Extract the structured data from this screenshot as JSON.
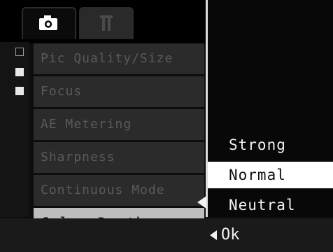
{
  "tabs": [
    {
      "icon": "camera-icon",
      "active": true
    },
    {
      "icon": "setup-wrench-icon",
      "active": false
    }
  ],
  "menu": {
    "items": [
      {
        "label": "Pic Quality/Size"
      },
      {
        "label": "Focus"
      },
      {
        "label": "AE Metering"
      },
      {
        "label": "Sharpness"
      },
      {
        "label": "Continuous Mode"
      },
      {
        "label": "Color Depth",
        "selected": true
      }
    ]
  },
  "options": {
    "items": [
      {
        "label": "Strong"
      },
      {
        "label": "Normal",
        "highlighted": true
      },
      {
        "label": "Neutral"
      }
    ]
  },
  "footer": {
    "hint": "Ok"
  }
}
